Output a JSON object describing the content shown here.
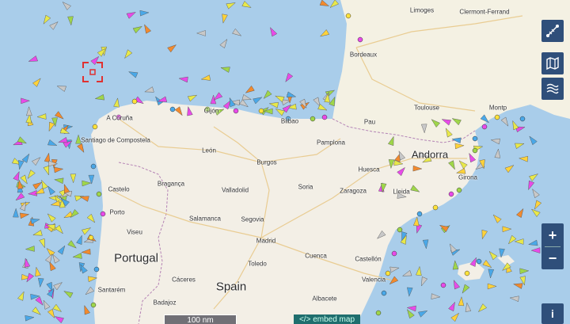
{
  "map": {
    "countries": [
      "Spain",
      "Portugal",
      "Andorra"
    ],
    "cities": [
      "Limoges",
      "Clermont-Ferrand",
      "Bordeaux",
      "Toulouse",
      "Montp",
      "A Coruña",
      "Santiago de Compostela",
      "Gijón",
      "Bilbao",
      "Pamplona",
      "León",
      "Burgos",
      "Huesca",
      "Girona",
      "Bragança",
      "Valladolid",
      "Soria",
      "Zaragoza",
      "Lleida",
      "Castelo",
      "Porto",
      "Salamanca",
      "Segovia",
      "Viseu",
      "Madrid",
      "Toledo",
      "Cuenca",
      "Castellón",
      "Valencia",
      "Santarém",
      "Cáceres",
      "Badajoz",
      "Albacete",
      "Pau"
    ]
  },
  "controls": {
    "scale_label": "100 nm",
    "embed_label": "</> embed map",
    "zoom_in": "+",
    "zoom_out": "−",
    "info": "i"
  },
  "icons": [
    "measure-icon",
    "map-layers-icon",
    "weather-icon",
    "info-icon"
  ],
  "colors": {
    "sea": "#a9cdea",
    "land": "#f3efe6",
    "france": "#f4f1e3",
    "control": "#2f4f7a",
    "border": "#b583b5"
  }
}
